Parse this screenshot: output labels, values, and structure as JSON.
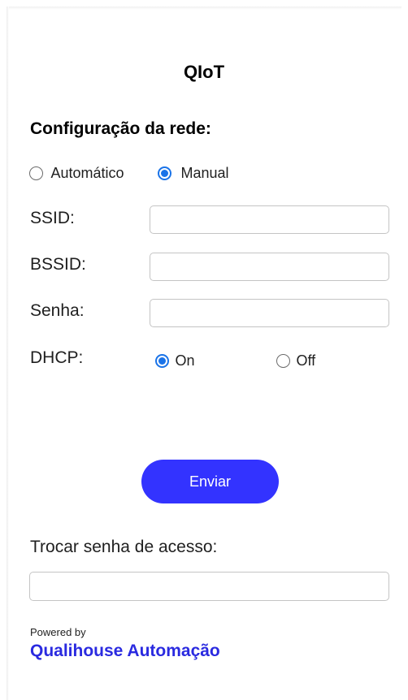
{
  "app": {
    "title": "QIoT"
  },
  "network": {
    "section_title": "Configuração da rede:",
    "mode_options": [
      {
        "label": "Automático",
        "checked": false
      },
      {
        "label": "Manual",
        "checked": true
      }
    ],
    "fields": {
      "ssid": {
        "label": "SSID:",
        "value": ""
      },
      "bssid": {
        "label": "BSSID:",
        "value": ""
      },
      "password": {
        "label": "Senha:",
        "value": ""
      }
    },
    "dhcp": {
      "label": "DHCP:",
      "options": [
        {
          "label": "On",
          "checked": true
        },
        {
          "label": "Off",
          "checked": false
        }
      ]
    },
    "submit_label": "Enviar"
  },
  "access": {
    "label": "Trocar senha de acesso:",
    "value": ""
  },
  "footer": {
    "powered_by": "Powered by",
    "brand": "Qualihouse Automação",
    "brand_color": "#2a2ae0"
  },
  "colors": {
    "accent_button": "#3333ff",
    "radio_checked": "#1a73e8"
  }
}
